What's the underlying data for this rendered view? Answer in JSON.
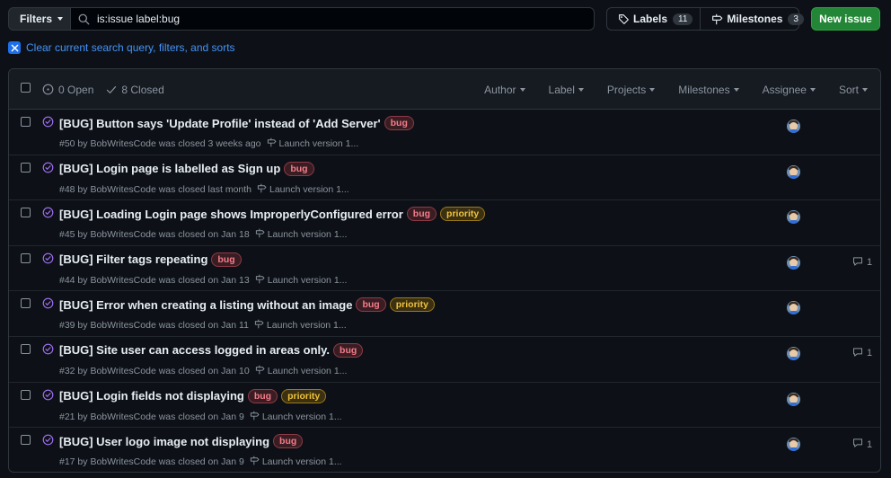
{
  "toolbar": {
    "filters_label": "Filters",
    "search_value": "is:issue label:bug",
    "labels_label": "Labels",
    "labels_count": "11",
    "milestones_label": "Milestones",
    "milestones_count": "3",
    "new_issue_label": "New issue"
  },
  "clear_search_label": "Clear current search query, filters, and sorts",
  "list_header": {
    "open_label": "0 Open",
    "closed_label": "8 Closed",
    "filters": [
      "Author",
      "Label",
      "Projects",
      "Milestones",
      "Assignee",
      "Sort"
    ]
  },
  "issues": [
    {
      "title": "[BUG] Button says 'Update Profile' instead of 'Add Server'",
      "labels": [
        "bug"
      ],
      "meta": "#50 by BobWritesCode was closed 3 weeks ago",
      "milestone": "Launch version 1...",
      "comments": ""
    },
    {
      "title": "[BUG] Login page is labelled as Sign up",
      "labels": [
        "bug"
      ],
      "meta": "#48 by BobWritesCode was closed last month",
      "milestone": "Launch version 1...",
      "comments": ""
    },
    {
      "title": "[BUG] Loading Login page shows ImproperlyConfigured error",
      "labels": [
        "bug",
        "priority"
      ],
      "meta": "#45 by BobWritesCode was closed on Jan 18",
      "milestone": "Launch version 1...",
      "comments": ""
    },
    {
      "title": "[BUG] Filter tags repeating",
      "labels": [
        "bug"
      ],
      "meta": "#44 by BobWritesCode was closed on Jan 13",
      "milestone": "Launch version 1...",
      "comments": "1"
    },
    {
      "title": "[BUG] Error when creating a listing without an image",
      "labels": [
        "bug",
        "priority"
      ],
      "meta": "#39 by BobWritesCode was closed on Jan 11",
      "milestone": "Launch version 1...",
      "comments": ""
    },
    {
      "title": "[BUG] Site user can access logged in areas only.",
      "labels": [
        "bug"
      ],
      "meta": "#32 by BobWritesCode was closed on Jan 10",
      "milestone": "Launch version 1...",
      "comments": "1"
    },
    {
      "title": "[BUG] Login fields not displaying",
      "labels": [
        "bug",
        "priority"
      ],
      "meta": "#21 by BobWritesCode was closed on Jan 9",
      "milestone": "Launch version 1...",
      "comments": ""
    },
    {
      "title": "[BUG] User logo image not displaying",
      "labels": [
        "bug"
      ],
      "meta": "#17 by BobWritesCode was closed on Jan 9",
      "milestone": "Launch version 1...",
      "comments": "1"
    }
  ],
  "colors": {
    "background": "#0d1117",
    "closed_icon": "#a371f7",
    "new_issue_button": "#238636",
    "link": "#4493f8",
    "bug_label": "#f47c8a",
    "priority_label": "#f0c33c"
  },
  "icons": {
    "search": "search-icon",
    "labels": "tag-icon",
    "milestones": "milestone-icon",
    "open": "issue-open-icon",
    "closed": "check-icon",
    "issue_closed": "issue-closed-icon",
    "comment": "comment-icon",
    "clear": "x-icon"
  }
}
